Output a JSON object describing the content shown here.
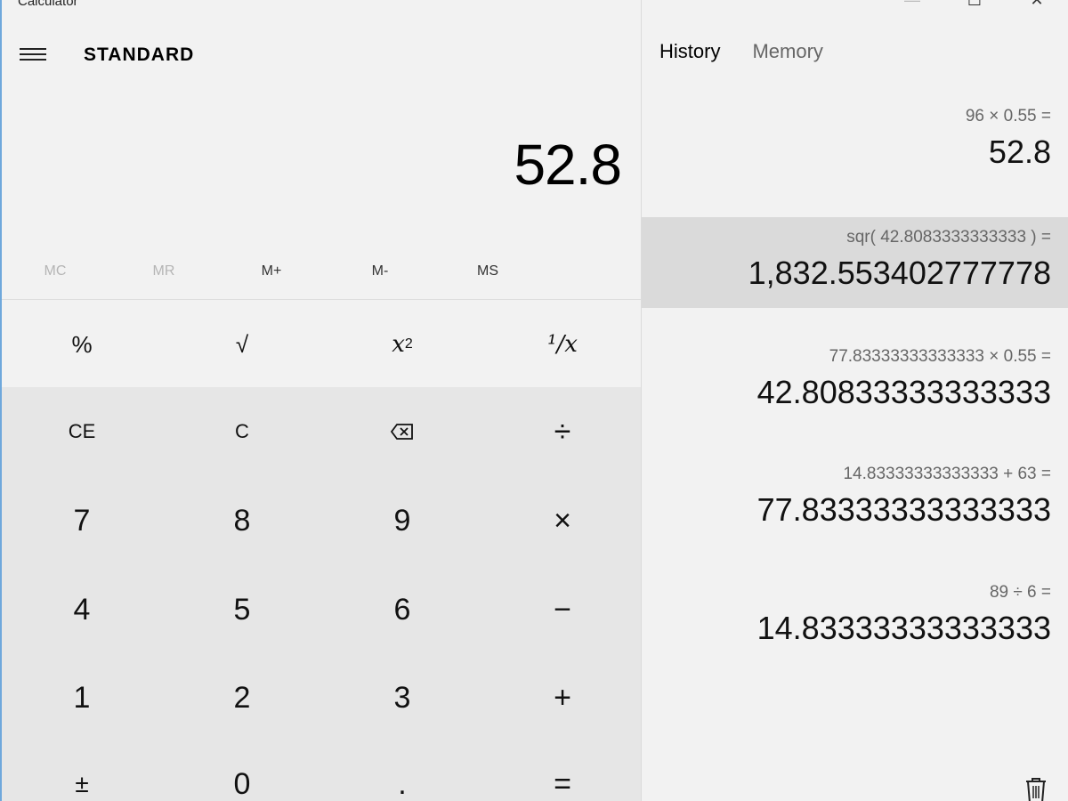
{
  "window": {
    "title": "Calculator",
    "minimize_icon": "minimize-icon",
    "maximize_icon": "maximize-icon",
    "close_icon": "close-icon",
    "minimize_glyph": "—",
    "maximize_glyph": "☐",
    "close_glyph": "✕"
  },
  "header": {
    "menu_icon": "hamburger-icon",
    "mode": "STANDARD"
  },
  "display": {
    "value": "52.8"
  },
  "memory": {
    "buttons": [
      {
        "label": "MC",
        "enabled": false
      },
      {
        "label": "MR",
        "enabled": false
      },
      {
        "label": "M+",
        "enabled": true
      },
      {
        "label": "M-",
        "enabled": true
      },
      {
        "label": "MS",
        "enabled": true
      }
    ]
  },
  "keypad": {
    "percent": "%",
    "sqrt": "√",
    "square_base": "x",
    "square_exp": "2",
    "reciprocal": "¹/x",
    "ce": "CE",
    "c": "C",
    "backspace_icon": "backspace-icon",
    "divide": "÷",
    "seven": "7",
    "eight": "8",
    "nine": "9",
    "multiply": "×",
    "four": "4",
    "five": "5",
    "six": "6",
    "minus": "−",
    "one": "1",
    "two": "2",
    "three": "3",
    "plus": "+",
    "negate": "±",
    "zero": "0",
    "decimal": ".",
    "equals": "="
  },
  "tabs": [
    {
      "label": "History",
      "active": true
    },
    {
      "label": "Memory",
      "active": false
    }
  ],
  "history": [
    {
      "expression": "96   ×   0.55 =",
      "result": "52.8"
    },
    {
      "expression": "sqr( 42.8083333333333 ) =",
      "result": "1,832.553402777778"
    },
    {
      "expression": "77.83333333333333   ×   0.55 =",
      "result": "42.80833333333333"
    },
    {
      "expression": "14.83333333333333   +   63 =",
      "result": "77.83333333333333"
    },
    {
      "expression": "89   ÷   6 =",
      "result": "14.83333333333333"
    }
  ],
  "footer": {
    "clear_history_icon": "trash-icon"
  },
  "colors": {
    "background": "#f2f2f2",
    "key_background": "#e6e6e6",
    "selected_history": "#dadada",
    "accent_edge": "#6fa8dc"
  }
}
